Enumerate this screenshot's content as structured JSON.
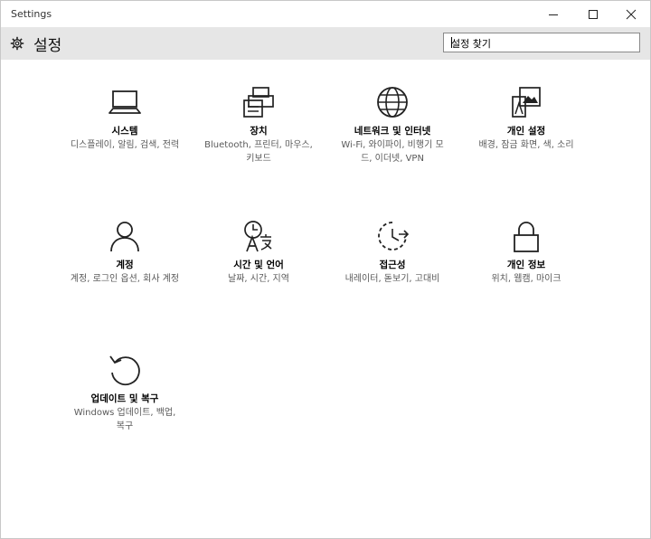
{
  "window": {
    "title": "Settings"
  },
  "header": {
    "title": "설정",
    "search_value": "설정 찾기"
  },
  "tiles": [
    {
      "name": "시스템",
      "desc": "디스플레이, 알림, 검색, 전력",
      "icon": "laptop-icon"
    },
    {
      "name": "장치",
      "desc": "Bluetooth, 프린터, 마우스, 키보드",
      "icon": "printer-icon"
    },
    {
      "name": "네트워크 및 인터넷",
      "desc": "Wi-Fi, 와이파이, 비행기 모드, 이더넷, VPN",
      "icon": "globe-icon"
    },
    {
      "name": "개인 설정",
      "desc": "배경, 잠금 화면, 색, 소리",
      "icon": "personalization-icon"
    },
    {
      "name": "계정",
      "desc": "계정, 로그인 옵션, 회사 계정",
      "icon": "person-icon"
    },
    {
      "name": "시간 및 언어",
      "desc": "날짜, 시간, 지역",
      "icon": "time-language-icon"
    },
    {
      "name": "접근성",
      "desc": "내레이터, 돋보기, 고대비",
      "icon": "ease-of-access-icon"
    },
    {
      "name": "개인 정보",
      "desc": "위치, 웹캠, 마이크",
      "icon": "lock-icon"
    },
    {
      "name": "업데이트 및 복구",
      "desc": "Windows 업데이트, 백업, 복구",
      "icon": "update-icon"
    }
  ]
}
